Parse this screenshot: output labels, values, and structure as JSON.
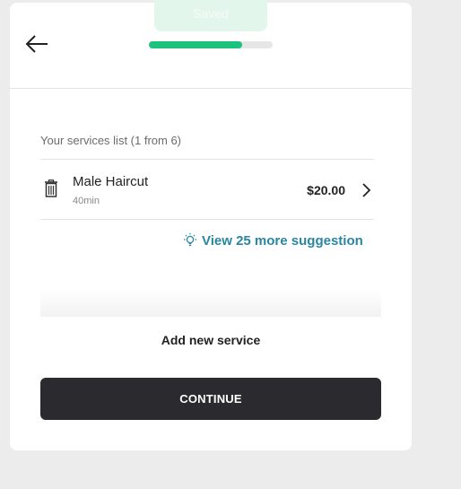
{
  "header": {
    "saved_label": "Saved",
    "progress_fraction": 0.75,
    "progress_color": "#1ec27c"
  },
  "services": {
    "caption": "Your services list (1 from 6)",
    "items": [
      {
        "name": "Male Haircut",
        "duration": "40min",
        "price": "$20.00"
      }
    ]
  },
  "suggestion": {
    "label": "View 25 more suggestion",
    "icon": "lightbulb-icon",
    "color": "#2a86a0"
  },
  "actions": {
    "add_new_label": "Add new service",
    "continue_label": "CONTINUE",
    "continue_color": "#2b2a2f"
  }
}
